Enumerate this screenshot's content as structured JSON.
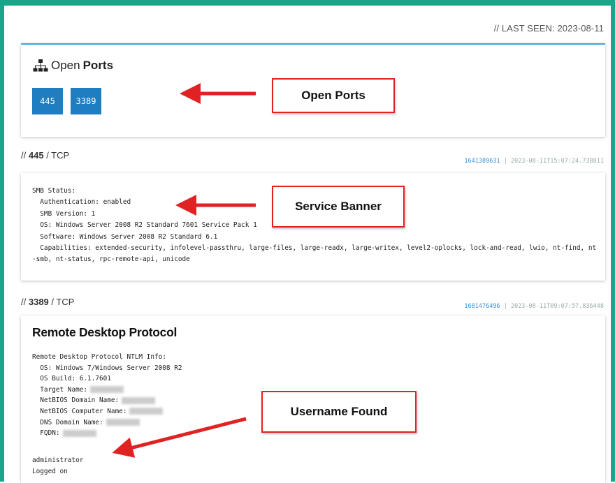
{
  "last_seen": "// LAST SEEN: 2023-08-11",
  "ports_card": {
    "title_light": "Open",
    "title_bold": "Ports",
    "icon": "network-icon",
    "ports": [
      "445",
      "3389"
    ]
  },
  "services": [
    {
      "slash": "//",
      "port": "445",
      "protocol": "/ TCP",
      "hash": "1641389631",
      "separator": "|",
      "timestamp": "2023-08-11T15:07:24.738811",
      "banner": [
        "SMB Status:",
        "  Authentication: enabled",
        "  SMB Version: 1",
        "  OS: Windows Server 2008 R2 Standard 7601 Service Pack 1",
        "  Software: Windows Server 2008 R2 Standard 6.1",
        "  Capabilities: extended-security, infolevel-passthru, large-files, large-readx, large-writex, level2-oplocks, lock-and-read, lwio, nt-find, nt",
        "-smb, nt-status, rpc-remote-api, unicode"
      ]
    },
    {
      "slash": "//",
      "port": "3389",
      "protocol": "/ TCP",
      "hash": "1681476496",
      "separator": "|",
      "timestamp": "2023-08-11T09:07:57.836448",
      "title": "Remote Desktop Protocol",
      "lines": [
        "Remote Desktop Protocol NTLM Info:",
        "  OS: Windows 7/Windows Server 2008 R2",
        "  OS Build: 6.1.7601",
        "  Target Name:",
        "  NetBIOS Domain Name:",
        "  NetBIOS Computer Name:",
        "  DNS Domain Name:",
        "  FQDN:"
      ],
      "user_lines": [
        "administrator",
        "Logged on"
      ]
    }
  ],
  "callouts": {
    "ports": "Open Ports",
    "banner": "Service Banner",
    "user": "Username Found"
  },
  "colors": {
    "frame": "#1aa58b",
    "accent": "#1f7ebf",
    "callout_border": "#e02222",
    "arrow": "#e02222"
  }
}
